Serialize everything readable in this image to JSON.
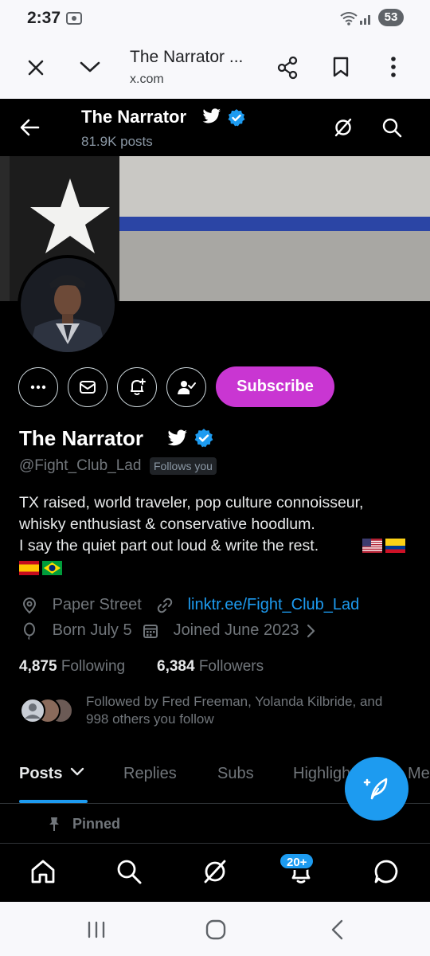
{
  "status_bar": {
    "time": "2:37",
    "battery": "53"
  },
  "browser": {
    "title": "The Narrator ...",
    "domain": "x.com"
  },
  "header": {
    "name": "The Narrator",
    "posts_count": "81.9K posts"
  },
  "profile": {
    "display_name": "The Narrator",
    "handle": "@Fight_Club_Lad",
    "follows_you": "Follows you",
    "subscribe_label": "Subscribe",
    "bio": [
      "TX raised, world traveler, pop culture connoisseur,",
      "whisky enthusiast & conservative hoodlum.",
      "I say the quiet part out loud & write the rest."
    ],
    "location": "Paper Street",
    "website": "linktr.ee/Fight_Club_Lad",
    "birthday": "Born July 5",
    "joined": "Joined June 2023",
    "following_count": "4,875",
    "following_label": "Following",
    "followers_count": "6,384",
    "followers_label": "Followers",
    "followed_by_line1": "Followed by Fred Freeman, Yolanda Kilbride, and",
    "followed_by_line2": "998 others you follow"
  },
  "tabs": [
    {
      "label": "Posts"
    },
    {
      "label": "Replies"
    },
    {
      "label": "Subs"
    },
    {
      "label": "Highlights"
    },
    {
      "label": "Media"
    }
  ],
  "pinned_label": "Pinned",
  "notifications_badge": "20+",
  "colors": {
    "accent": "#1d9bf0",
    "subscribe": "#c936d2",
    "verified": "#1d9bf0",
    "background": "#000000"
  },
  "icons": [
    "close-icon",
    "chevron-down-icon",
    "share-icon",
    "bookmark-icon",
    "more-vert-icon",
    "back-arrow-icon",
    "grok-icon",
    "search-icon",
    "more-icon",
    "mail-icon",
    "notify-add-icon",
    "follow-check-icon",
    "location-icon",
    "link-icon",
    "balloon-icon",
    "calendar-icon",
    "pin-icon",
    "home-icon",
    "bell-icon",
    "chat-icon",
    "compose-icon"
  ]
}
